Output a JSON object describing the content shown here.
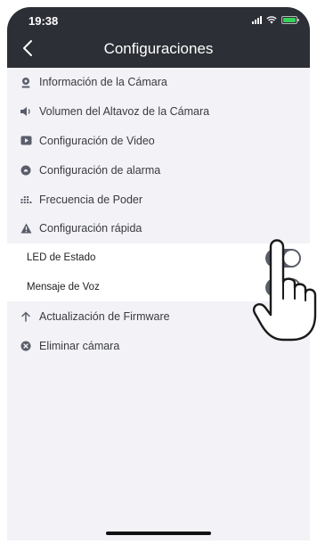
{
  "status_bar": {
    "time": "19:38"
  },
  "header": {
    "title": "Configuraciones"
  },
  "menu": {
    "camera_info": "Información de la Cámara",
    "speaker_volume": "Volumen del Altavoz de la Cámara",
    "video_settings": "Configuración de Video",
    "alarm_settings": "Configuración de alarma",
    "power_frequency": "Frecuencia de Poder",
    "quick_settings": "Configuración rápida",
    "status_led": "LED de Estado",
    "voice_message": "Mensaje de Voz",
    "firmware_update": "Actualización de Firmware",
    "delete_camera": "Eliminar cámara"
  },
  "toggles": {
    "status_led_on": true,
    "voice_message_on": true
  },
  "colors": {
    "header_bg": "#2d2f36",
    "list_bg": "#f2f2f7",
    "subitem_bg": "#ffffff",
    "icon": "#5a5e6a",
    "toggle_on": "#5a5e6a"
  }
}
